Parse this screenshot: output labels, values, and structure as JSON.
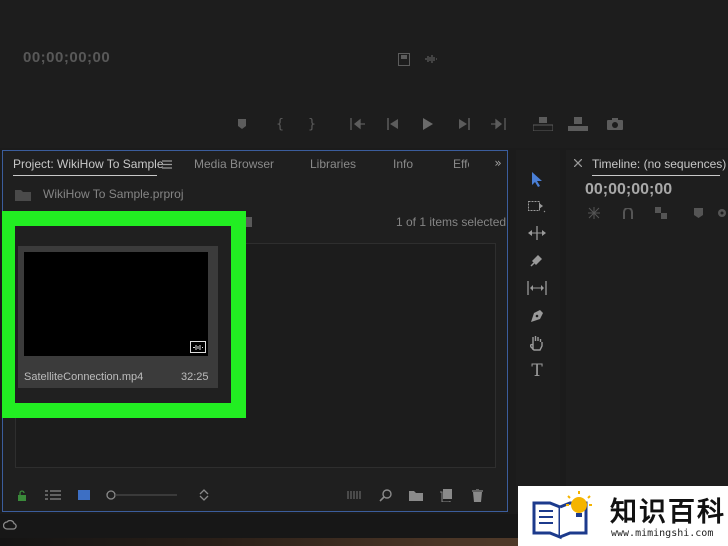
{
  "monitor": {
    "timecode": "00;00;00;00"
  },
  "project_panel": {
    "tabs": [
      {
        "label": "Project: WikiHow To Sample"
      },
      {
        "label": "Media Browser"
      },
      {
        "label": "Libraries"
      },
      {
        "label": "Info"
      },
      {
        "label": "Effe"
      }
    ],
    "project_file": "WikiHow To Sample.prproj",
    "selection_count": "1 of 1 items selected",
    "clip": {
      "name": "SatelliteConnection.mp4",
      "duration": "32:25"
    },
    "highlight_color": "#22ee22",
    "accent_color": "#3b5d9c"
  },
  "tools": [
    {
      "icon": "selection-tool-icon"
    },
    {
      "icon": "track-select-tool-icon"
    },
    {
      "icon": "ripple-edit-tool-icon"
    },
    {
      "icon": "razor-tool-icon"
    },
    {
      "icon": "slip-tool-icon"
    },
    {
      "icon": "pen-tool-icon"
    },
    {
      "icon": "hand-tool-icon"
    },
    {
      "icon": "type-tool-icon"
    }
  ],
  "timeline": {
    "title": "Timeline: (no sequences)",
    "timecode": "00;00;00;00"
  },
  "watermark": {
    "text_cn": "知识百科",
    "url": "www.mimingshi.com"
  }
}
